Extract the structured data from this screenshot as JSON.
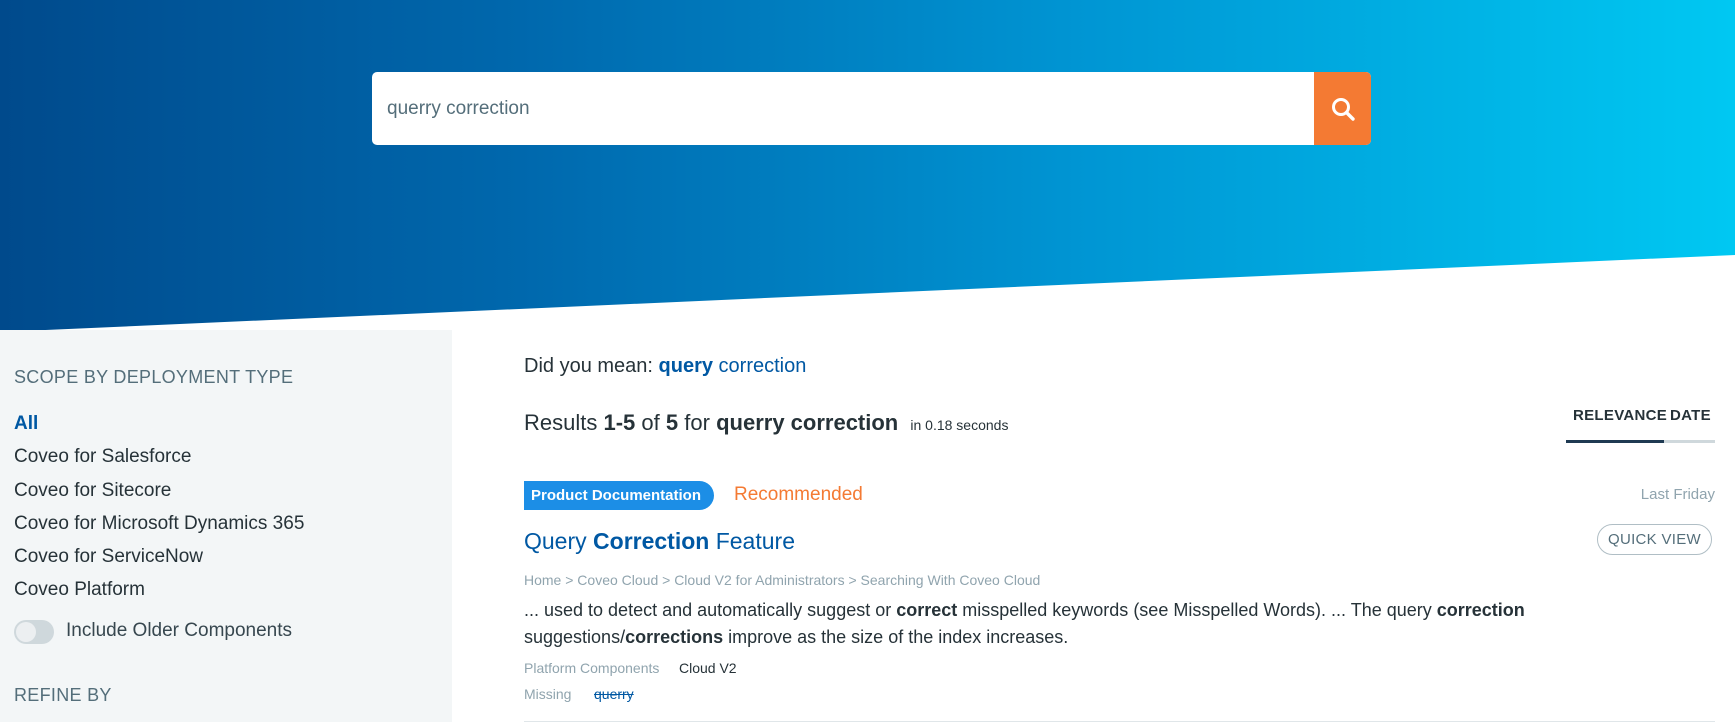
{
  "search": {
    "query": "querry correction",
    "button_icon": "search-icon"
  },
  "colors": {
    "accent": "#f47a33",
    "link": "#0058a3",
    "badge": "#1c8ee6",
    "hero_start": "#004a8c",
    "hero_end": "#00c8f2"
  },
  "sidebar": {
    "scope_title": "SCOPE BY DEPLOYMENT TYPE",
    "scope_items": [
      {
        "label": "All",
        "selected": true
      },
      {
        "label": "Coveo for Salesforce",
        "selected": false
      },
      {
        "label": "Coveo for Sitecore",
        "selected": false
      },
      {
        "label": "Coveo for Microsoft Dynamics 365",
        "selected": false
      },
      {
        "label": "Coveo for ServiceNow",
        "selected": false
      },
      {
        "label": "Coveo Platform",
        "selected": false
      }
    ],
    "toggle_label": "Include Older Components",
    "toggle_on": false,
    "refine_title": "REFINE BY"
  },
  "did_you_mean": {
    "prefix": "Did you mean: ",
    "corrected_word": "query",
    "rest": " correction"
  },
  "summary": {
    "results_word": "Results",
    "range": "1-5",
    "of_word": "of",
    "total": "5",
    "for_word": "for",
    "query": "querry correction",
    "duration": "in 0.18 seconds"
  },
  "sort": {
    "options": [
      "RELEVANCE",
      "DATE"
    ],
    "active": "RELEVANCE"
  },
  "result": {
    "badge": "Product Documentation",
    "recommended": "Recommended",
    "date": "Last Friday",
    "title_part1": "Query ",
    "title_bold": "Correction",
    "title_part2": " Feature",
    "quick_view": "QUICK VIEW",
    "breadcrumb": "Home > Coveo Cloud > Cloud V2 for Administrators > Searching With Coveo Cloud",
    "excerpt": {
      "t1": "... used to detect and automatically suggest or ",
      "b1": "correct",
      "t2": " misspelled keywords (see Misspelled Words). ... The query ",
      "b2": "correction",
      "t3": " suggestions/",
      "b3": "corrections",
      "t4": " improve as the size of the index increases."
    },
    "field_label": "Platform Components",
    "field_value": "Cloud V2",
    "missing_label": "Missing",
    "missing_term": "querry"
  }
}
